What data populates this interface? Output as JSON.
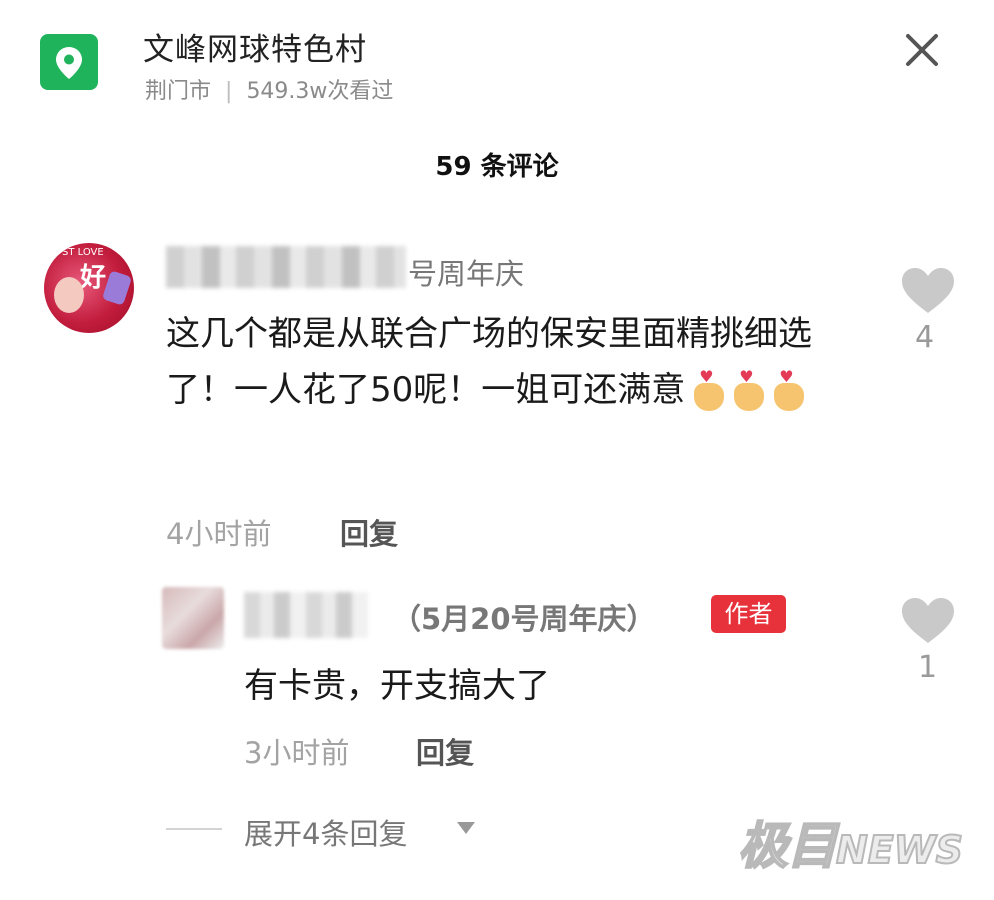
{
  "header": {
    "location_icon": "location-pin-icon",
    "title": "文峰网球特色村",
    "city": "荆门市",
    "separator": "|",
    "views": "549.3w次看过",
    "close_icon": "close-icon"
  },
  "comments_title": "59 条评论",
  "comments": [
    {
      "username_visible_suffix": "号周年庆",
      "text": "这几个都是从联合广场的保安里面精挑细选了！一人花了50呢！一姐可还满意",
      "emoji": [
        "finger-heart-emoji",
        "finger-heart-emoji",
        "finger-heart-emoji"
      ],
      "time": "4小时前",
      "reply_label": "回复",
      "like_icon": "heart-icon",
      "likes": "4",
      "avatar_text": "好",
      "avatar_top_text": "ST LOVE"
    }
  ],
  "replies": [
    {
      "username_suffix": "（5月20号周年庆）",
      "badge": "作者",
      "text": "有卡贵，开支搞大了",
      "time": "3小时前",
      "reply_label": "回复",
      "like_icon": "heart-icon",
      "likes": "1"
    }
  ],
  "expand_replies": "展开4条回复",
  "watermark": {
    "cn": "极目",
    "en": "NEWS"
  },
  "colors": {
    "accent_green": "#1fb35c",
    "author_badge": "#e7323c",
    "heart_gray": "#c9c9c9"
  }
}
